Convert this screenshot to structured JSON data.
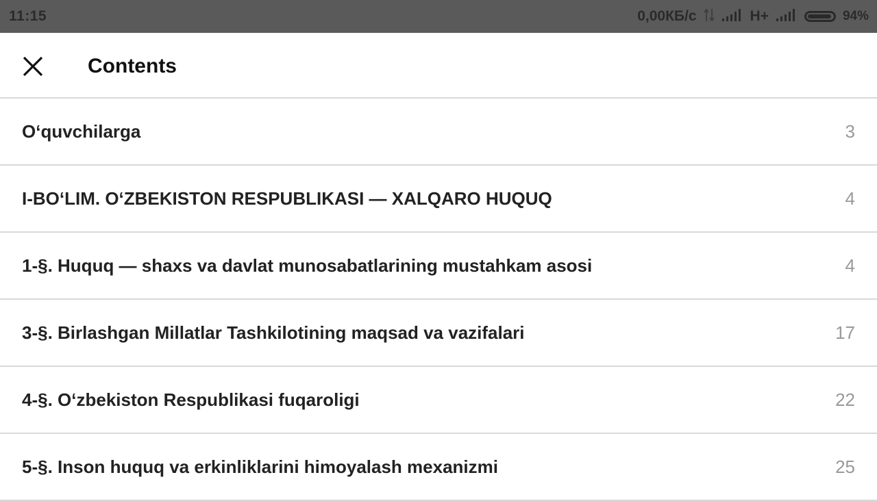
{
  "status_bar": {
    "time": "11:15",
    "speed": "0,00КБ/с",
    "network": "H+",
    "battery_percent": "94%",
    "battery_level": 0.94
  },
  "header": {
    "title": "Contents",
    "close_icon": "close-icon"
  },
  "toc": [
    {
      "title": "O‘quvchilarga",
      "page": "3"
    },
    {
      "title": "I-BO‘LIM. O‘ZBEKISTON RESPUBLIKASI — XALQARO HUQUQ",
      "page": "4"
    },
    {
      "title": "1-§. Huquq — shaxs va davlat munosabatlarining mustahkam asosi",
      "page": "4"
    },
    {
      "title": "3-§. Birlashgan Millatlar Tashkilotining maqsad va vazifalari",
      "page": "17"
    },
    {
      "title": "4-§. O‘zbekiston Respublikasi fuqaroligi",
      "page": "22"
    },
    {
      "title": "5-§. Inson huquq va erkinliklarini himoyalash mexanizmi",
      "page": "25"
    }
  ]
}
